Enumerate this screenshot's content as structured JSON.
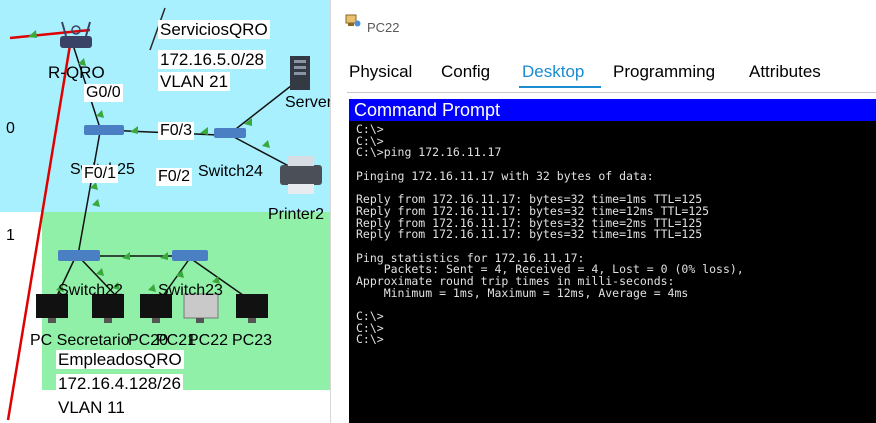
{
  "topology": {
    "services_zone": {
      "name": "ServiciosQRO",
      "network": "172.16.5.0/28",
      "vlan": "VLAN 21"
    },
    "employees_zone": {
      "name": "EmpleadosQRO",
      "network": "172.16.4.128/26",
      "vlan": "VLAN 11"
    },
    "devices": {
      "router": "R-QRO",
      "server": "Server",
      "printer": "Printer2",
      "switch25": "Switch25",
      "switch24": "Switch24",
      "switch22": "Switch22",
      "switch23": "Switch23",
      "pc_secretario": "PC Secretario",
      "pc20": "PC20",
      "pc21": "PC21",
      "pc22": "PC22",
      "pc23": "PC23"
    },
    "ports": {
      "g0_0": "G0/0",
      "f0_3": "F0/3",
      "f0_1": "F0/1",
      "f0_2": "F0/2"
    },
    "edge_marks": {
      "mark_a": "0",
      "mark_b": "1"
    }
  },
  "window": {
    "title": "PC22",
    "tabs": [
      {
        "label": "Physical",
        "active": false
      },
      {
        "label": "Config",
        "active": false
      },
      {
        "label": "Desktop",
        "active": true
      },
      {
        "label": "Programming",
        "active": false
      },
      {
        "label": "Attributes",
        "active": false
      }
    ],
    "accent_color": "#1a8ccf"
  },
  "command_prompt": {
    "title": "Command Prompt",
    "header_color": "#0000ff",
    "lines": [
      "C:\\>",
      "C:\\>",
      "C:\\>ping 172.16.11.17",
      "",
      "Pinging 172.16.11.17 with 32 bytes of data:",
      "",
      "Reply from 172.16.11.17: bytes=32 time=1ms TTL=125",
      "Reply from 172.16.11.17: bytes=32 time=12ms TTL=125",
      "Reply from 172.16.11.17: bytes=32 time=2ms TTL=125",
      "Reply from 172.16.11.17: bytes=32 time=1ms TTL=125",
      "",
      "Ping statistics for 172.16.11.17:",
      "    Packets: Sent = 4, Received = 4, Lost = 0 (0% loss),",
      "Approximate round trip times in milli-seconds:",
      "    Minimum = 1ms, Maximum = 12ms, Average = 4ms",
      "",
      "C:\\>",
      "C:\\>",
      "C:\\>"
    ]
  }
}
